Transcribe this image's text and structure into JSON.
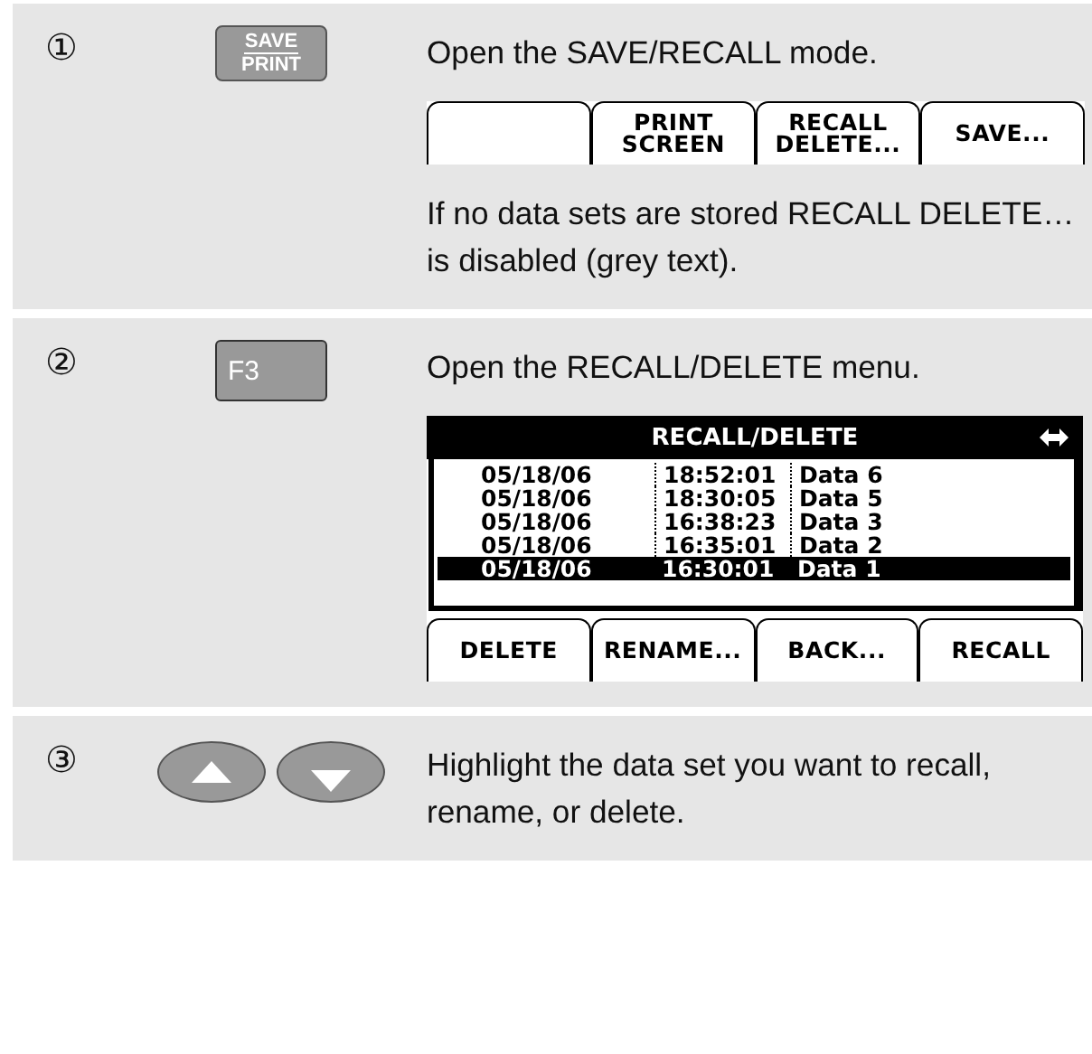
{
  "steps": [
    {
      "number": "①",
      "key": {
        "kind": "stacked",
        "lines": [
          "SAVE",
          "PRINT"
        ]
      },
      "texts": [
        "Open the SAVE/RECALL mode."
      ],
      "screen": {
        "kind": "softkeys",
        "softkeys": [
          {
            "kind": "blank"
          },
          {
            "kind": "label",
            "lines": [
              "PRINT",
              "SCREEN"
            ]
          },
          {
            "kind": "label",
            "lines": [
              "RECALL",
              "DELETE..."
            ]
          },
          {
            "kind": "label",
            "lines": [
              "SAVE..."
            ]
          }
        ]
      },
      "after": [
        "If no data sets are stored RECALL DELETE… is disabled (grey text)."
      ]
    },
    {
      "number": "②",
      "key": {
        "kind": "single",
        "lines": [
          "F3"
        ]
      },
      "texts": [
        "Open the RECALL/DELETE menu."
      ],
      "screen": {
        "kind": "menu",
        "title": "RECALL/DELETE",
        "rows": [
          {
            "date": "05/18/06",
            "time": "18:52:01",
            "name": "Data 6",
            "selected": false
          },
          {
            "date": "05/18/06",
            "time": "18:30:05",
            "name": "Data 5",
            "selected": false
          },
          {
            "date": "05/18/06",
            "time": "16:38:23",
            "name": "Data 3",
            "selected": false
          },
          {
            "date": "05/18/06",
            "time": "16:35:01",
            "name": "Data 2",
            "selected": false
          },
          {
            "date": "05/18/06",
            "time": "16:30:01",
            "name": "Data 1",
            "selected": true
          }
        ],
        "softkeys": [
          {
            "kind": "label",
            "lines": [
              "DELETE"
            ]
          },
          {
            "kind": "label",
            "lines": [
              "RENAME..."
            ]
          },
          {
            "kind": "label",
            "lines": [
              "BACK..."
            ]
          },
          {
            "kind": "label",
            "lines": [
              "RECALL"
            ]
          }
        ]
      }
    },
    {
      "number": "③",
      "key": {
        "kind": "arrows"
      },
      "texts": [
        "Highlight the data set you want to recall, rename, or delete."
      ]
    }
  ]
}
